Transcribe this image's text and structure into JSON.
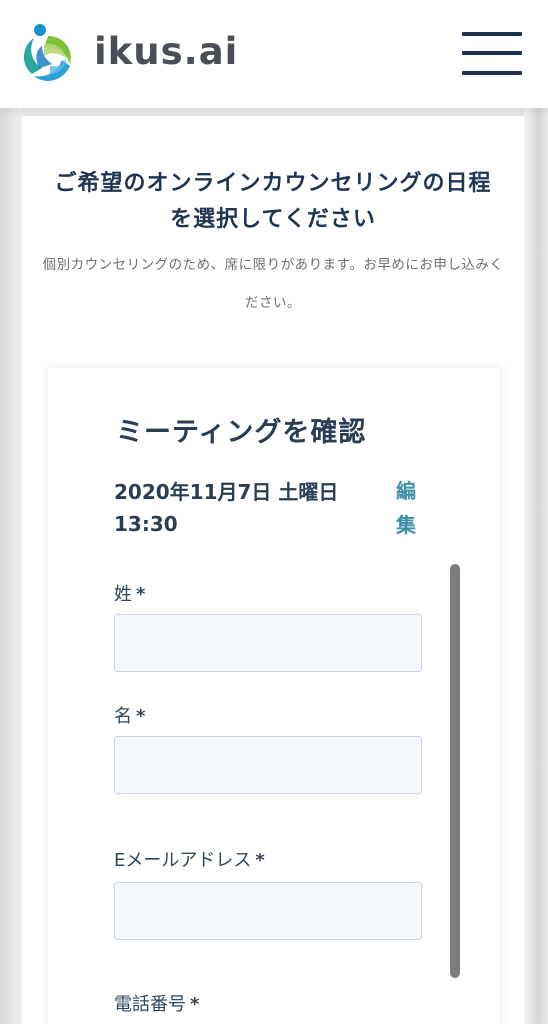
{
  "header": {
    "logo_text": "ikus.ai",
    "logo_icon": "ikus-logo-icon",
    "menu_icon": "hamburger-icon"
  },
  "page": {
    "title": "ご希望のオンラインカウンセリングの日程を選択してください",
    "subtitle": "個別カウンセリングのため、席に限りがあります。お早めにお申し込みください。"
  },
  "meeting": {
    "heading": "ミーティングを確認",
    "datetime": "2020年11月7日 土曜日 13:30",
    "edit_label": "編集"
  },
  "form": {
    "last_name_label": "姓",
    "first_name_label": "名",
    "email_label": "Eメールアドレス",
    "phone_label": "電話番号",
    "required_mark": "*",
    "last_name_value": "",
    "first_name_value": "",
    "email_value": ""
  },
  "colors": {
    "navy": "#1f3553",
    "link": "#3f8fa8",
    "input_bg": "#f5f8fa",
    "input_border": "#cbd6e2"
  }
}
